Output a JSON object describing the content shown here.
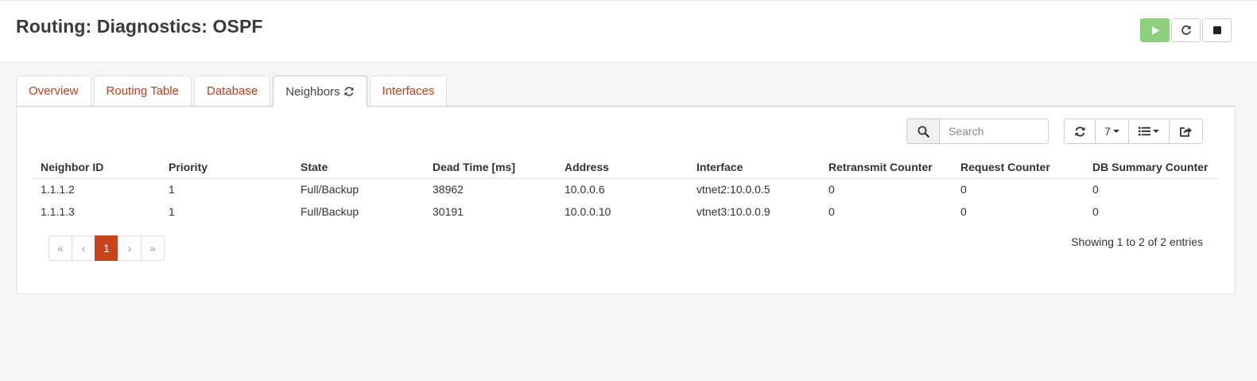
{
  "page": {
    "title": "Routing: Diagnostics: OSPF"
  },
  "service": {
    "buttons": [
      {
        "name": "play-icon",
        "color": "#8fd07f"
      },
      {
        "name": "restart-icon"
      },
      {
        "name": "stop-icon"
      }
    ]
  },
  "tabs": [
    {
      "label": "Overview",
      "active": false
    },
    {
      "label": "Routing Table",
      "active": false
    },
    {
      "label": "Database",
      "active": false
    },
    {
      "label": "Neighbors",
      "active": true,
      "icon": "refresh-icon"
    },
    {
      "label": "Interfaces",
      "active": false
    }
  ],
  "toolbar": {
    "search_placeholder": "Search",
    "search_value": "",
    "row_count": "7",
    "refresh_icon": "refresh-icon",
    "columns_icon": "list-icon",
    "export_icon": "export-icon"
  },
  "table": {
    "columns": [
      "Neighbor ID",
      "Priority",
      "State",
      "Dead Time [ms]",
      "Address",
      "Interface",
      "Retransmit Counter",
      "Request Counter",
      "DB Summary Counter"
    ],
    "rows": [
      [
        "1.1.1.2",
        "1",
        "Full/Backup",
        "38962",
        "10.0.0.6",
        "vtnet2:10.0.0.5",
        "0",
        "0",
        "0"
      ],
      [
        "1.1.1.3",
        "1",
        "Full/Backup",
        "30191",
        "10.0.0.10",
        "vtnet3:10.0.0.9",
        "0",
        "0",
        "0"
      ]
    ]
  },
  "pagination": {
    "first": "«",
    "prev": "‹",
    "current": "1",
    "next": "›",
    "last": "»",
    "info": "Showing 1 to 2 of 2 entries"
  },
  "colors": {
    "accent": "#c8431b",
    "link": "#c0401a",
    "background": "#f4f7f5",
    "play": "#8fd07f"
  }
}
